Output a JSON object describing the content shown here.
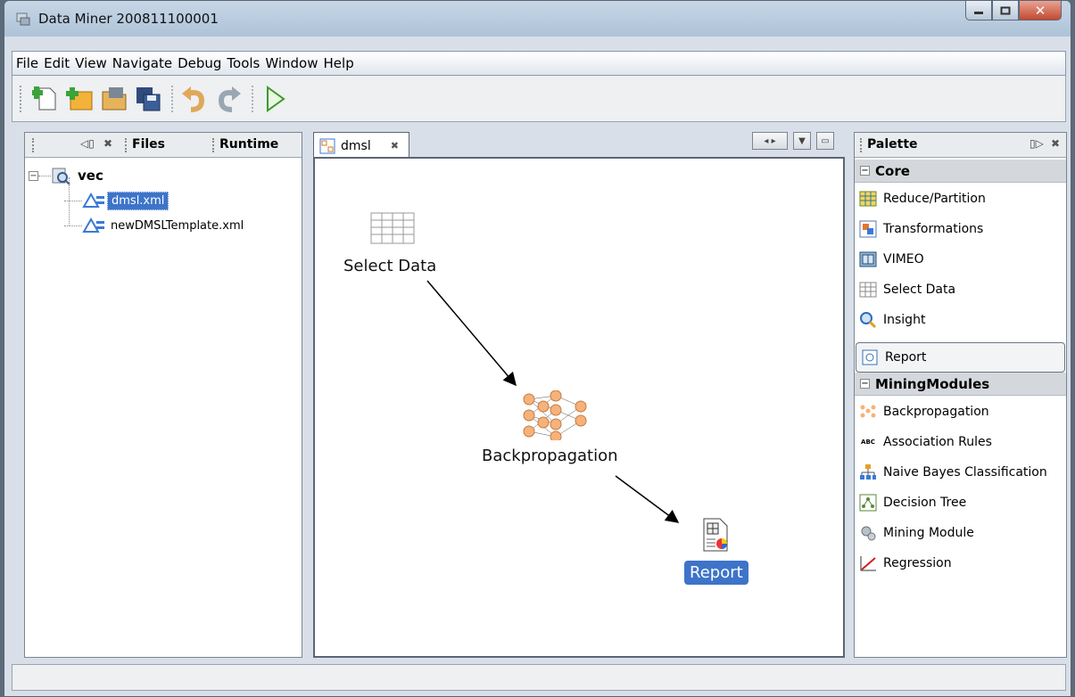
{
  "window": {
    "title": "Data Miner 200811100001"
  },
  "menu": [
    "File",
    "Edit",
    "View",
    "Navigate",
    "Debug",
    "Tools",
    "Window",
    "Help"
  ],
  "left": {
    "tabs": {
      "files": "Files",
      "runtime": "Runtime"
    },
    "tree": {
      "root": "vec",
      "files": [
        "dmsl.xml",
        "newDMSLTemplate.xml"
      ]
    }
  },
  "editor": {
    "tab": "dmsl",
    "nodes": {
      "select": "Select Data",
      "backprop": "Backpropagation",
      "report": "Report"
    }
  },
  "palette": {
    "title": "Palette",
    "core_label": "Core",
    "core": [
      "Reduce/Partition",
      "Transformations",
      "VIMEO",
      "Select Data",
      "Insight",
      "Report"
    ],
    "mining_label": "MiningModules",
    "mining": [
      "Backpropagation",
      "Association Rules",
      "Naive Bayes Classification",
      "Decision Tree",
      "Mining Module",
      "Regression"
    ]
  },
  "colors": {
    "selection": "#3d74c9",
    "title_bar": "#b6c8db",
    "close_button": "#c84d33"
  }
}
